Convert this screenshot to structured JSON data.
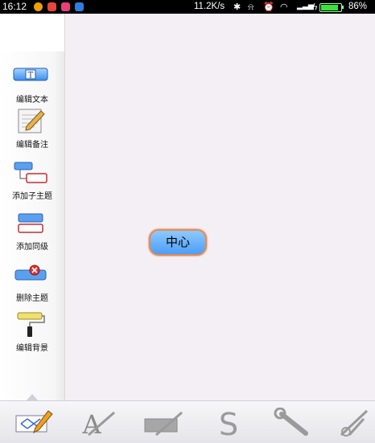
{
  "status_bar": {
    "time": "16:12",
    "net_speed": "11.2K/s",
    "battery_percent": "86%",
    "battery_level": 0.86,
    "icons": [
      "notification-icon-1",
      "notification-icon-2",
      "notification-icon-3",
      "notification-icon-4",
      "bluetooth-icon",
      "alarm-off-icon",
      "alarm-icon",
      "wifi-icon",
      "signal-icon",
      "charging-icon",
      "battery-icon"
    ]
  },
  "sidebar": {
    "items": [
      {
        "label": "编辑文本",
        "icon": "edit-text-icon"
      },
      {
        "label": "编辑备注",
        "icon": "edit-note-icon"
      },
      {
        "label": "添加子主题",
        "icon": "add-subtopic-icon"
      },
      {
        "label": "添加同级",
        "icon": "add-sibling-icon"
      },
      {
        "label": "删除主题",
        "icon": "delete-topic-icon"
      },
      {
        "label": "编辑背景",
        "icon": "edit-background-icon"
      }
    ],
    "edit_text_glyph": "T"
  },
  "canvas": {
    "center_topic": "中心"
  },
  "bottom_toolbar": {
    "items": [
      "mindmap-edit-icon",
      "font-style-icon",
      "pen-icon",
      "link-s-icon",
      "wrench-icon",
      "scissors-icon"
    ],
    "font_glyph": "A",
    "link_glyph": "S"
  },
  "colors": {
    "node_fill": "#5aa8f8",
    "node_border": "#e58a52",
    "canvas_bg": "#f4eff4"
  }
}
